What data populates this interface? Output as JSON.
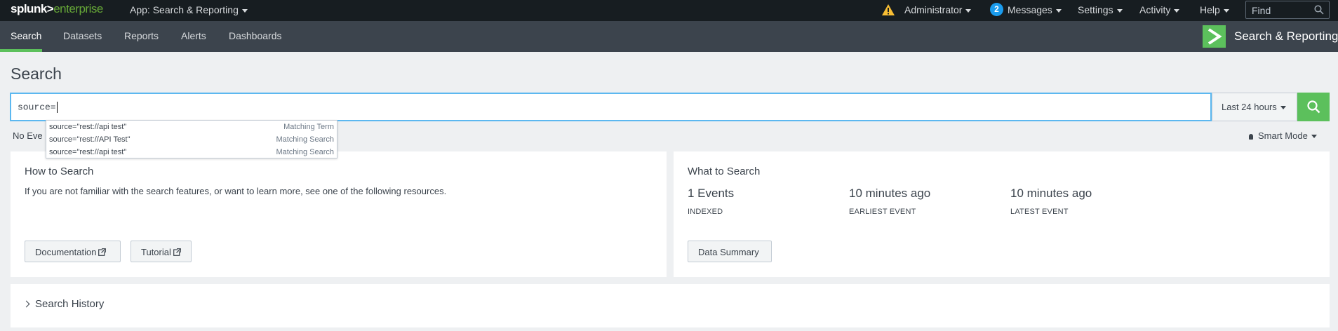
{
  "topbar": {
    "logo_prefix": "splunk>",
    "logo_suffix": "enterprise",
    "app_menu": "App: Search & Reporting",
    "admin": "Administrator",
    "messages_count": "2",
    "messages": "Messages",
    "settings": "Settings",
    "activity": "Activity",
    "help": "Help",
    "find_placeholder": "Find"
  },
  "appbar": {
    "tabs": [
      "Search",
      "Datasets",
      "Reports",
      "Alerts",
      "Dashboards"
    ],
    "app_name": "Search & Reporting"
  },
  "search": {
    "page_title": "Search",
    "query": "source=",
    "time_range": "Last 24 hours",
    "status_text": "No Eve",
    "mode": "Smart Mode"
  },
  "autocomplete": [
    {
      "term": "source=\"rest://api test\"",
      "kind": "Matching Term"
    },
    {
      "term": "source=\"rest://API Test\"",
      "kind": "Matching Search"
    },
    {
      "term": "source=\"rest://api test\"",
      "kind": "Matching Search"
    }
  ],
  "how_to": {
    "title": "How to Search",
    "desc": "If you are not familiar with the search features, or want to learn more, see one of the following resources.",
    "documentation": "Documentation",
    "tutorial": "Tutorial"
  },
  "what_to": {
    "title": "What to Search",
    "stats": [
      {
        "value": "1 Events",
        "label": "INDEXED"
      },
      {
        "value": "10 minutes ago",
        "label": "EARLIEST EVENT"
      },
      {
        "value": "10 minutes ago",
        "label": "LATEST EVENT"
      }
    ],
    "data_summary": "Data Summary"
  },
  "history": {
    "title": "Search History"
  },
  "colors": {
    "accent": "#5cc05c",
    "topbar": "#171d21",
    "appbar": "#3c444d",
    "focus": "#5cb8f0"
  }
}
